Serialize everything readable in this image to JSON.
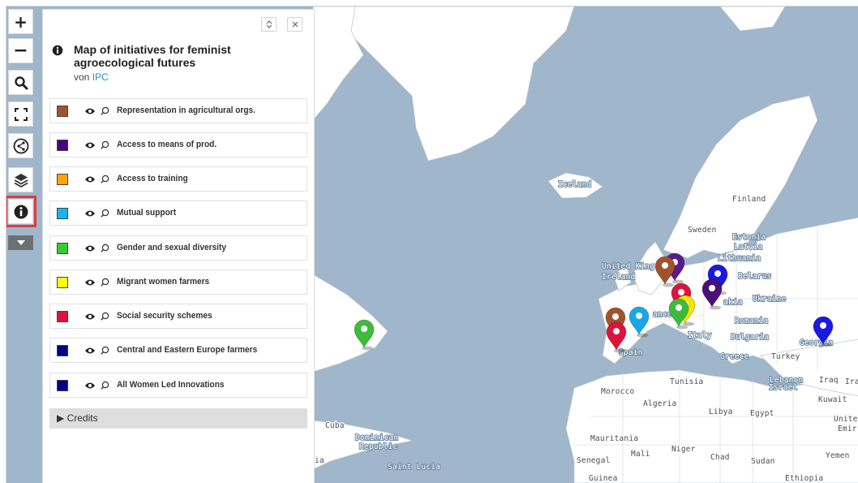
{
  "map": {
    "labels": {
      "iceland": "Iceland",
      "finland": "Finland",
      "sweden": "Sweden",
      "estonia": "Estonia",
      "latvia": "Latvia",
      "lithuania": "Lithuania",
      "united_kingdom": "United King",
      "ireland": "Ireland",
      "belarus": "Belarus",
      "ukraine": "Ukraine",
      "slovakia": "akia",
      "france": "ance",
      "romania": "Romania",
      "bulgaria": "Bulgaria",
      "italy": "Italy",
      "georgia": "Georgia",
      "spain": "Spain",
      "greece": "Greece",
      "turkey": "Turkey",
      "tunisia": "Tunisia",
      "lebanon": "Lebanon",
      "israel": "Israel",
      "iraq": "Iraq",
      "iran": "Ira",
      "kuwait": "Kuwait",
      "morocco": "Morocco",
      "algeria": "Algeria",
      "libya": "Libya",
      "egypt": "Egypt",
      "uae_1": "Unite",
      "uae_2": "Emir",
      "cuba": "Cuba",
      "dominican_1": "Dominican",
      "dominican_2": "Republic",
      "mauritania": "Mauritania",
      "mali": "Mali",
      "niger": "Niger",
      "chad": "Chad",
      "sudan": "Sudan",
      "yemen": "Yemen",
      "senegal": "Senegal",
      "saint_lucia": "Saint Lucia",
      "guinea": "Guinea",
      "ethiopia": "Ethiopia",
      "ia": "ia"
    },
    "markers": [
      {
        "name": "marker-north-america",
        "color": "#3dbb3d"
      },
      {
        "name": "marker-uk-purple",
        "color": "#5a1a8a"
      },
      {
        "name": "marker-uk-brown",
        "color": "#a0522d"
      },
      {
        "name": "marker-belarus",
        "color": "#1919e6"
      },
      {
        "name": "marker-poland",
        "color": "#4b0f7a"
      },
      {
        "name": "marker-central-red",
        "color": "#dc143c"
      },
      {
        "name": "marker-central-yellow",
        "color": "#f3e600"
      },
      {
        "name": "marker-central-green",
        "color": "#3dbb3d"
      },
      {
        "name": "marker-france-cyan",
        "color": "#17a7ea"
      },
      {
        "name": "marker-spain-brown",
        "color": "#a0522d"
      },
      {
        "name": "marker-spain-red",
        "color": "#dc143c"
      },
      {
        "name": "marker-georgia",
        "color": "#1919e6"
      }
    ]
  },
  "controls": {
    "zoom_in": "+",
    "zoom_out": "−"
  },
  "panel": {
    "title": "Map of initiatives for feminist agroecological futures",
    "byline_prefix": "von",
    "author": "IPC",
    "credits": "Credits",
    "layers": [
      {
        "label": "Representation in agricultural orgs.",
        "color": "#a0522d"
      },
      {
        "label": "Access to means of prod.",
        "color": "#4b0082"
      },
      {
        "label": "Access to training",
        "color": "#ffa500"
      },
      {
        "label": "Mutual support",
        "color": "#17b5f0"
      },
      {
        "label": "Gender and sexual diversity",
        "color": "#33cc33"
      },
      {
        "label": "Migrant women farmers",
        "color": "#ffff00"
      },
      {
        "label": "Social security schemes",
        "color": "#dc143c"
      },
      {
        "label": "Central and Eastern Europe farmers",
        "color": "#00008b"
      },
      {
        "label": "All Women Led Innovations",
        "color": "#00008b"
      }
    ]
  }
}
